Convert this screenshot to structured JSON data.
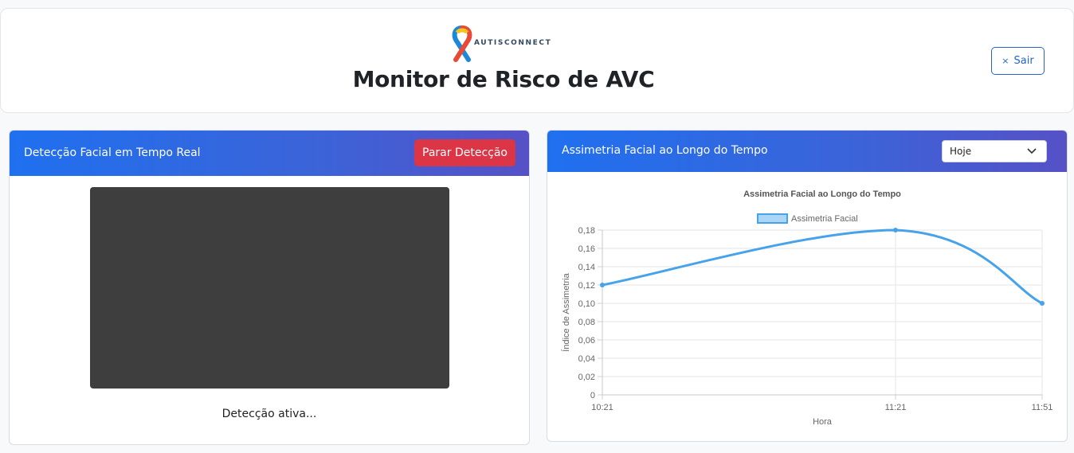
{
  "header": {
    "logo_text": "AUTISCONNECT",
    "title": "Monitor de Risco de AVC",
    "logout_icon": "×",
    "logout_label": "Sair"
  },
  "detection": {
    "title": "Detecção Facial em Tempo Real",
    "stop_label": "Parar Detecção",
    "status": "Detecção ativa..."
  },
  "asymmetry": {
    "title": "Assimetria Facial ao Longo do Tempo",
    "period_selected": "Hoje"
  },
  "colors": {
    "stop_button": "#dc3545",
    "series": "#46a3ea",
    "accent": "#2566c4"
  },
  "chart_data": {
    "type": "line",
    "title": "Assimetria Facial ao Longo do Tempo",
    "xlabel": "Hora",
    "ylabel": "Índice de Assimetria",
    "categories": [
      "10:21",
      "11:21",
      "11:51"
    ],
    "x_minutes": [
      0,
      60,
      90
    ],
    "series": [
      {
        "name": "Assimetria Facial",
        "values": [
          0.12,
          0.18,
          0.1
        ]
      }
    ],
    "ylim": [
      0,
      0.18
    ],
    "yticks": [
      0,
      0.02,
      0.04,
      0.06,
      0.08,
      0.1,
      0.12,
      0.14,
      0.16,
      0.18
    ],
    "ytick_labels": [
      "0",
      "0,02",
      "0,04",
      "0,06",
      "0,08",
      "0,10",
      "0,12",
      "0,14",
      "0,16",
      "0,18"
    ],
    "grid": true,
    "legend": "top"
  }
}
